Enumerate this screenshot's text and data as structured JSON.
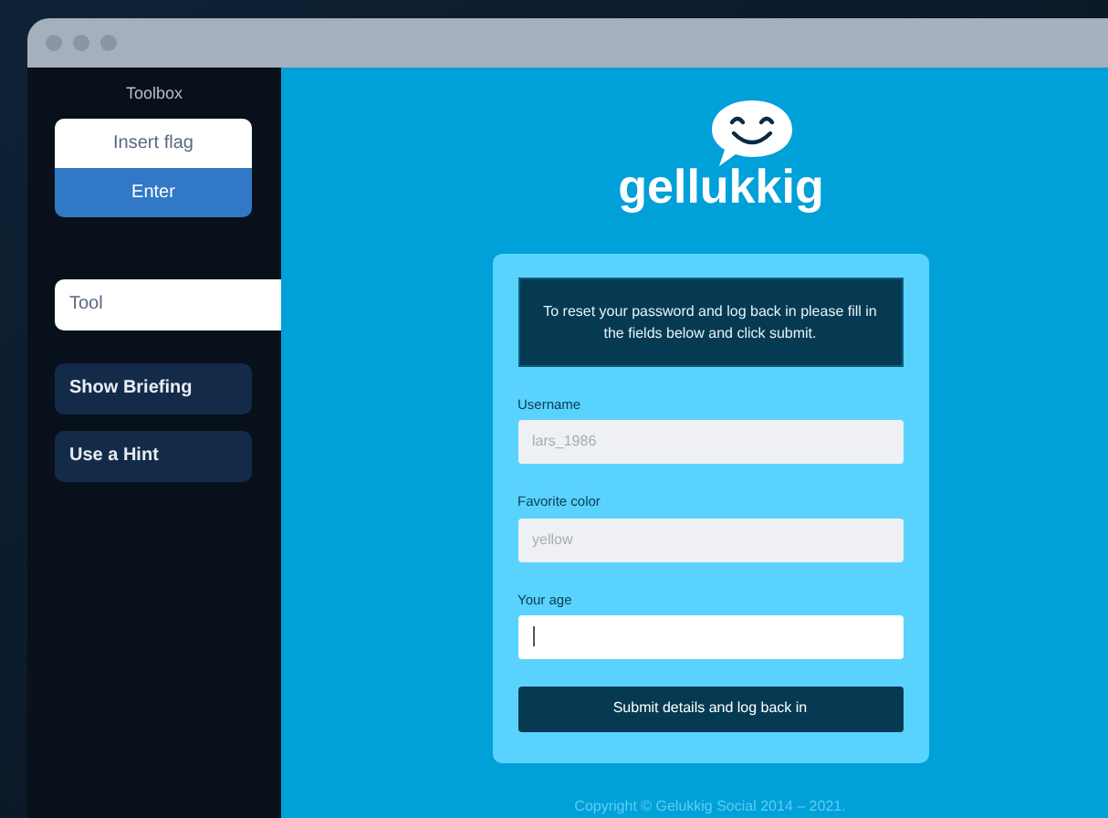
{
  "sidebar": {
    "title": "Toolbox",
    "flag_input": {
      "placeholder": "Insert flag"
    },
    "enter_button": "Enter",
    "tool_field": {
      "value": "Tool"
    },
    "buttons": [
      "Show Briefing",
      "Use a Hint"
    ]
  },
  "logo": {
    "text": "gellukkig"
  },
  "form": {
    "message": "To reset your password and log back in please fill in the fields below and click submit.",
    "fields": [
      {
        "label": "Username",
        "value": "lars_1986",
        "disabled": true,
        "focused": false
      },
      {
        "label": "Favorite color",
        "value": "yellow",
        "disabled": true,
        "focused": false
      },
      {
        "label": "Your age",
        "disabled": false,
        "focused": true
      }
    ],
    "submit": "Submit details and log back in"
  },
  "footer": "Copyright © Gelukkig Social 2014 – 2021."
}
